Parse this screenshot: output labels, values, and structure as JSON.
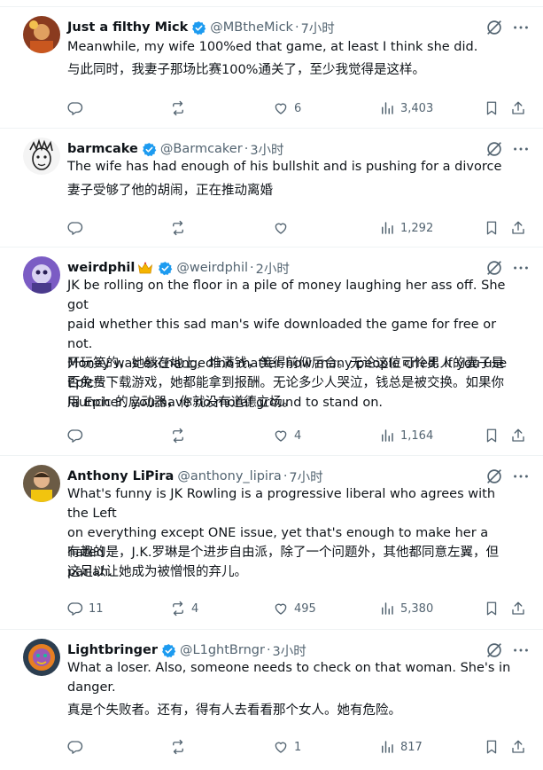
{
  "tweets": [
    {
      "name": "Just a filthy Mick",
      "handle": "@MBtheMick",
      "time": "7小时",
      "text_en": "Meanwhile, my wife 100%ed that game, at least I think she did.",
      "text_zh": "与此同时，我妻子那场比赛100%通关了，至少我觉得是这样。",
      "replies": "",
      "reposts": "",
      "likes": "6",
      "views": "3,403"
    },
    {
      "name": "barmcake",
      "handle": "@Barmcaker",
      "time": "3小时",
      "text_en": "The wife has had enough of his bullshit and is pushing for a divorce",
      "text_zh": "妻子受够了他的胡闹，正在推动离婚",
      "replies": "",
      "reposts": "",
      "likes": "",
      "views": "1,292"
    },
    {
      "name": "weirdphil",
      "handle": "@weirdphil",
      "time": "2小时",
      "text_en": "JK be rolling on the floor in a pile of money laughing her ass off. She got\npaid whether this sad man's wife downloaded the game for free or not.\nMoney was exchanged no matter how many people cried. If you use Epic's\nlauncher, you have no moral ground to stand on.",
      "text_zh": "开玩笑的，她躺在地上，堆满钱，笑得前仰后合。无论这位可怜男人的妻子是\n否免费下载游戏，她都能拿到报酬。无论多少人哭泣，钱总是被交换。如果你\n用 Epic 的启动器，你就没有道德立场。",
      "replies": "",
      "reposts": "",
      "likes": "4",
      "views": "1,164"
    },
    {
      "name": "Anthony LiPira",
      "handle": "@anthony_lipira",
      "time": "7小时",
      "text_en": "What's funny is JK Rowling is a progressive liberal who agrees with the Left\non everything except ONE issue, yet that's enough to make her a hated\npariah.",
      "text_zh": "有趣的是，J.K.罗琳是个进步自由派，除了一个问题外，其他都同意左翼，但\n这足以让她成为被憎恨的弃儿。",
      "replies": "11",
      "reposts": "4",
      "likes": "495",
      "views": "5,380"
    },
    {
      "name": "Lightbringer",
      "handle": "@L1ghtBrngr",
      "time": "3小时",
      "text_en": "What a loser. Also, someone needs to check on that woman. She's in\ndanger.",
      "text_zh": "真是个失败者。还有，得有人去看看那个女人。她有危险。",
      "replies": "",
      "reposts": "",
      "likes": "1",
      "views": "817"
    }
  ],
  "colors": {
    "verified": "#1d9bf0",
    "text_secondary": "#536471",
    "border": "#eff3f4"
  }
}
